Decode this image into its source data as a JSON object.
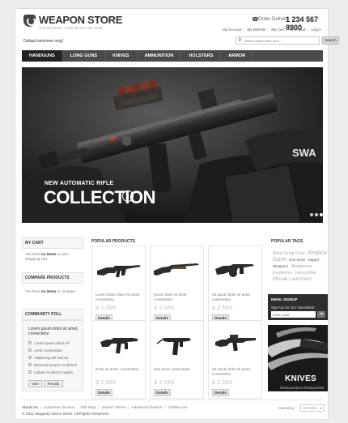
{
  "header": {
    "logo_title": "WEAPON STORE",
    "logo_subtitle": "THE BIGGEST CHOICE ON THE WEB",
    "phone_label": "Order Delivery",
    "phone_number": "1 234 567 8900",
    "top_links": [
      "My Account",
      "My Wishlist",
      "My Cart",
      "Checkout",
      "Log In"
    ],
    "welcome": "Default welcome msg!",
    "search_placeholder": "Search entire store here...",
    "search_button": "Search"
  },
  "nav": {
    "items": [
      "HANDGUNS",
      "LONG GUNS",
      "KNIVES",
      "AMMUNITION",
      "HOLSTERS",
      "ARMOR"
    ],
    "active": "HANDGUNS"
  },
  "banner": {
    "subtitle": "NEW AUTOMATIC RIFLE",
    "title": "COLLECTION",
    "arrow": "›",
    "slide_count": 3,
    "active_slide": 1
  },
  "sidebar": {
    "cart": {
      "title": "MY CART",
      "text_before": "You have ",
      "bold": "no items",
      "text_after": " in your shopping cart."
    },
    "compare": {
      "title": "COMPARE PRODUCTS",
      "text_before": "You have ",
      "bold": "no items",
      "text_after": " to compare."
    },
    "poll": {
      "title": "COMMUNITY POLL",
      "question": "Lorem ipsum dolor sit amet, consectetur",
      "options": [
        "Lorem ipsum dolor sit",
        "Amet consectetur",
        "Adipiscing elit sed do",
        "Eiusmod tempor incididunt",
        "Labore et dolore magna"
      ],
      "vote_label": "Vote",
      "results_label": "Results"
    }
  },
  "products": {
    "title": "POPULAR PRODUCTS",
    "items": [
      {
        "desc": "Lorem ipsum dolor sit amet, consectetur",
        "price": "$ 2,589",
        "button": "Details",
        "icon": "assault-rifle"
      },
      {
        "desc": "Ipsum dolor sit amet, consectetur",
        "price": "$ 2,589",
        "button": "Details",
        "icon": "shotgun"
      },
      {
        "desc": "Sit ipsum dolor sit amet, consectetur",
        "price": "$ 2,589",
        "button": "Details",
        "icon": "drum-shotgun"
      },
      {
        "desc": "Dolor sit amet, consectetur",
        "price": "$ 2,589",
        "button": "Details",
        "icon": "submachine-gun"
      },
      {
        "desc": "Sed amet, consectetur",
        "price": "$ 2,589",
        "button": "Details",
        "icon": "uzi"
      },
      {
        "desc": "Sit ipsum dolor sit amet, consectetur",
        "price": "$ 2,589",
        "button": "Details",
        "icon": "carbine"
      }
    ]
  },
  "tags": {
    "title": "POPULAR TAGS",
    "items": [
      {
        "label": "Blank Firing Guns",
        "size": 5
      },
      {
        "label": "Replica Guns",
        "size": 7
      },
      {
        "label": "Non Guns",
        "size": 4.5
      },
      {
        "label": "Edged Weapons",
        "size": 4.5
      },
      {
        "label": "Wudgeons",
        "size": 5.5
      },
      {
        "label": "Explosives",
        "size": 5
      },
      {
        "label": "Less-Lethal",
        "size": 5
      },
      {
        "label": "Missile Launchers",
        "size": 6
      }
    ]
  },
  "newsletter": {
    "title": "EMAIL SIGNUP",
    "label": "Sign Up for Our Newsletter:",
    "placeholder": "Enter email",
    "button_icon": "arrow-right-icon"
  },
  "promo": {
    "title": "KNIVES",
    "subtitle": "FROM WORLD PRODUCERS"
  },
  "footer": {
    "links": [
      "About Us",
      "Customer Service",
      "Site Map",
      "Search Terms",
      "Advanced Search",
      "Contact Us"
    ],
    "copyright": "© 2011 Magento Demo Store. All Rights Reserved.",
    "currency_label": "Currency:",
    "currency_value": "US Dollar"
  }
}
